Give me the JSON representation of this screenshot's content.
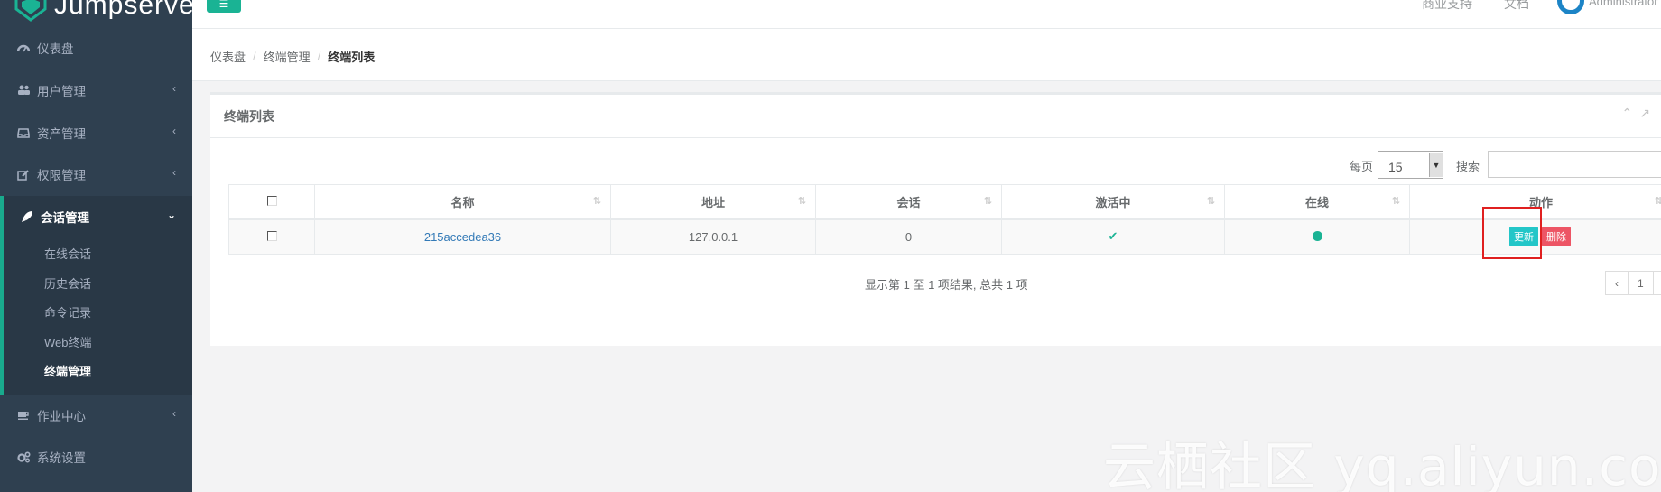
{
  "app": {
    "name": "Jumpserver"
  },
  "topbar": {
    "commercial_support": "商业支持",
    "docs": "文档",
    "user": "Administrator"
  },
  "sidebar": {
    "items": [
      {
        "label": "仪表盘",
        "icon": "dashboard-icon"
      },
      {
        "label": "用户管理",
        "icon": "users-icon"
      },
      {
        "label": "资产管理",
        "icon": "inbox-icon"
      },
      {
        "label": "权限管理",
        "icon": "edit-icon"
      },
      {
        "label": "会话管理",
        "icon": "rocket-icon"
      },
      {
        "label": "作业中心",
        "icon": "coffee-icon"
      },
      {
        "label": "系统设置",
        "icon": "gears-icon"
      }
    ],
    "subitems": [
      "在线会话",
      "历史会话",
      "命令记录",
      "Web终端",
      "终端管理"
    ]
  },
  "breadcrumb": [
    "仪表盘",
    "终端管理",
    "终端列表"
  ],
  "panel": {
    "title": "终端列表",
    "per_page_label": "每页",
    "per_page_value": "15",
    "search_label": "搜索"
  },
  "table": {
    "headers": [
      "名称",
      "地址",
      "会话",
      "激活中",
      "在线",
      "动作"
    ],
    "rows": [
      {
        "name": "215accedea36",
        "address": "127.0.0.1",
        "sessions": "0",
        "active": true,
        "online": true,
        "update_label": "更新",
        "delete_label": "删除"
      }
    ]
  },
  "info": "显示第 1 至 1 项结果, 总共 1 项",
  "pager": {
    "prev": "‹",
    "page": "1"
  },
  "watermark": "云栖社区 yq.aliyun.com",
  "colors": {
    "sidebar": "#2f4050",
    "accent": "#1ab394",
    "update": "#23c6c8",
    "delete": "#ed5565",
    "highlight": "#e02020"
  }
}
